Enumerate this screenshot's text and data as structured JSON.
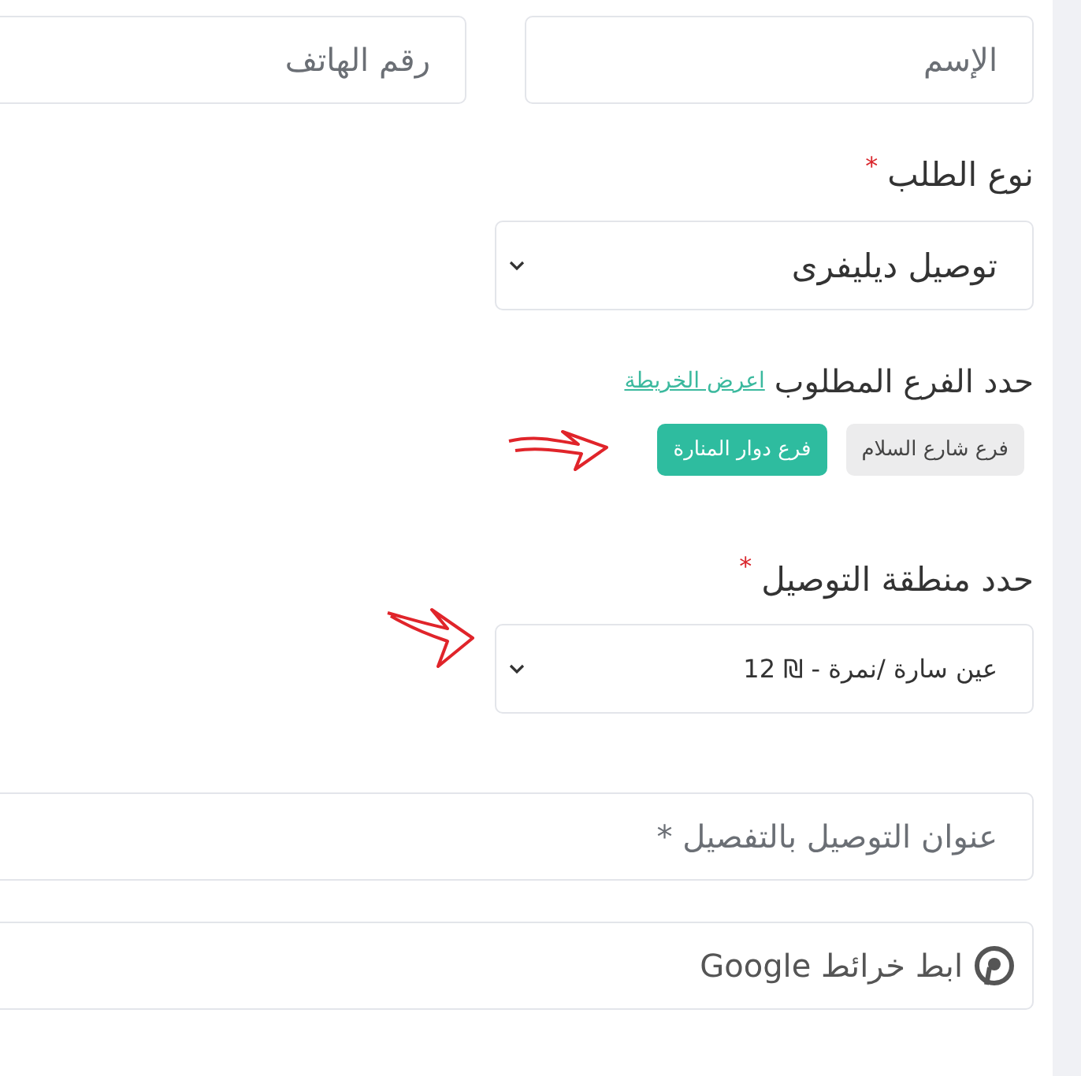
{
  "contact": {
    "name_placeholder": "الإسم",
    "phone_placeholder": "رقم الهاتف"
  },
  "order_type": {
    "label": "نوع الطلب",
    "required_mark": "*",
    "value": "توصيل ديليفرى"
  },
  "branch": {
    "label": "حدد الفرع المطلوب",
    "map_link": "اعرض الخريطة",
    "options": [
      {
        "label": "فرع شارع السلام",
        "selected": false
      },
      {
        "label": "فرع دوار المنارة",
        "selected": true
      }
    ]
  },
  "delivery_zone": {
    "label": "حدد منطقة التوصيل",
    "required_mark": "*",
    "value": "عين سارة /نمرة - ₪ 12"
  },
  "address": {
    "placeholder": "عنوان التوصيل بالتفصيل *"
  },
  "maps_link": {
    "placeholder": "ابط خرائط Google"
  }
}
